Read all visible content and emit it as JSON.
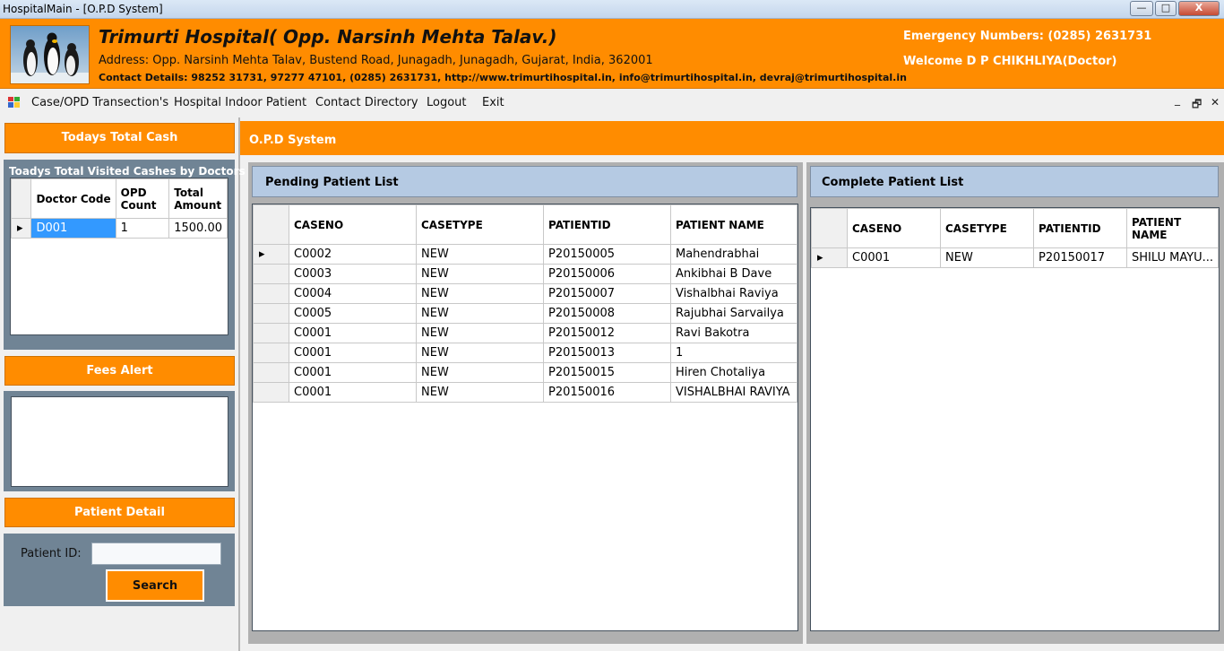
{
  "window": {
    "title": "HospitalMain - [O.P.D System]",
    "min_glyph": "—",
    "max_glyph": "□",
    "close_glyph": "X"
  },
  "header": {
    "hospital_name": "Trimurti Hospital( Opp. Narsinh Mehta Talav.)",
    "address": "Address: Opp. Narsinh Mehta Talav, Bustend Road, Junagadh, Junagadh, Gujarat, India, 362001",
    "contact": "Contact Details: 98252 31731, 97277 47101, (0285) 2631731, http://www.trimurtihospital.in, info@trimurtihospital.in, devraj@trimurtihospital.in",
    "emergency": "Emergency Numbers: (0285) 2631731",
    "welcome": "Welcome D P CHIKHLIYA(Doctor)"
  },
  "menu": {
    "items": [
      "Case/OPD Transection's",
      "Hospital Indoor Patient",
      "Contact Directory",
      "Logout",
      "Exit"
    ],
    "mdi_min": "_",
    "mdi_restore": "🗗",
    "mdi_close": "✕"
  },
  "left": {
    "todays_cash_button": "Todays Total Cash",
    "visited_title": "Toadys Total Visited Cashes by Doctors",
    "doctor_headers": [
      "Doctor Code",
      "OPD Count",
      "Total Amount"
    ],
    "doctor_rows": [
      [
        "D001",
        "1",
        "1500.00"
      ]
    ],
    "fees_alert_button": "Fees Alert",
    "patient_detail_button": "Patient Detail",
    "patient_id_label": "Patient ID:",
    "patient_id_value": "",
    "search_button": "Search"
  },
  "opd": {
    "title": "O.P.D System",
    "pending": {
      "title": "Pending Patient List",
      "headers": [
        "CASENO",
        "CASETYPE",
        "PATIENTID",
        "PATIENT NAME"
      ],
      "rows": [
        [
          "C0002",
          "NEW",
          "P20150005",
          "Mahendrabhai"
        ],
        [
          "C0003",
          "NEW",
          "P20150006",
          "Ankibhai B Dave"
        ],
        [
          "C0004",
          "NEW",
          "P20150007",
          "Vishalbhai Raviya"
        ],
        [
          "C0005",
          "NEW",
          "P20150008",
          "Rajubhai Sarvailya"
        ],
        [
          "C0001",
          "NEW",
          "P20150012",
          "Ravi Bakotra"
        ],
        [
          "C0001",
          "NEW",
          "P20150013",
          "1"
        ],
        [
          "C0001",
          "NEW",
          "P20150015",
          "Hiren Chotaliya"
        ],
        [
          "C0001",
          "NEW",
          "P20150016",
          "VISHALBHAI RAVIYA"
        ]
      ]
    },
    "complete": {
      "title": "Complete Patient List",
      "headers": [
        "CASENO",
        "CASETYPE",
        "PATIENTID",
        "PATIENT NAME"
      ],
      "rows": [
        [
          "C0001",
          "NEW",
          "P20150017",
          "SHILU MAYU..."
        ]
      ]
    }
  },
  "colors": {
    "accent_orange": "#ff8c00",
    "panel_blue": "#b5cae3",
    "slate": "#708495",
    "selected_cell": "#3399ff"
  }
}
